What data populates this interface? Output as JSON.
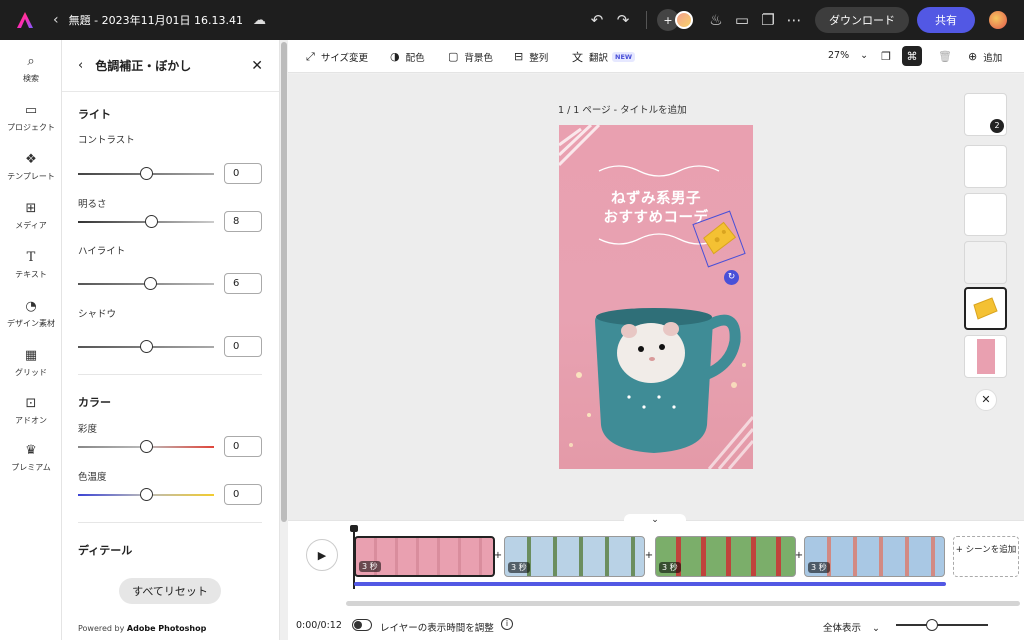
{
  "topbar": {
    "title": "無題 - 2023年11月01日 16.13.41",
    "download_label": "ダウンロード",
    "share_label": "共有"
  },
  "rail": {
    "items": [
      {
        "label": "検索",
        "icon": "search-icon"
      },
      {
        "label": "プロジェクト",
        "icon": "folder-icon"
      },
      {
        "label": "テンプレート",
        "icon": "template-icon"
      },
      {
        "label": "メディア",
        "icon": "media-icon"
      },
      {
        "label": "テキスト",
        "icon": "text-icon"
      },
      {
        "label": "デザイン素材",
        "icon": "shapes-icon"
      },
      {
        "label": "グリッド",
        "icon": "grid-icon"
      },
      {
        "label": "アドオン",
        "icon": "addon-icon"
      },
      {
        "label": "プレミアム",
        "icon": "crown-icon"
      }
    ]
  },
  "panel": {
    "title": "色調補正・ぼかし",
    "light": {
      "title": "ライト",
      "contrast": {
        "label": "コントラスト",
        "value": "0",
        "fraction": 0.5
      },
      "brightness": {
        "label": "明るさ",
        "value": "8",
        "fraction": 0.54
      },
      "highlight": {
        "label": "ハイライト",
        "value": "6",
        "fraction": 0.53
      },
      "shadow": {
        "label": "シャドウ",
        "value": "0",
        "fraction": 0.5
      }
    },
    "color": {
      "title": "カラー",
      "saturation": {
        "label": "彩度",
        "value": "0",
        "fraction": 0.5
      },
      "temperature": {
        "label": "色温度",
        "value": "0",
        "fraction": 0.5
      }
    },
    "detail": {
      "title": "ディテール"
    },
    "reset_label": "すべてリセット",
    "powered_prefix": "Powered by ",
    "powered_brand": "Adobe Photoshop"
  },
  "toolbar": {
    "resize": "サイズ変更",
    "colors": "配色",
    "background": "背景色",
    "arrange": "整列",
    "translate": "翻訳",
    "new_badge": "NEW",
    "zoom": "27%",
    "add": "追加"
  },
  "canvas": {
    "page_label": "1 / 1 ページ - タイトルを追加",
    "headline_1": "ねずみ系男子",
    "headline_2": "おすすめコーデ"
  },
  "thumbs": {
    "badge": "2"
  },
  "timeline": {
    "clips": [
      {
        "duration": "3 秒"
      },
      {
        "duration": "3 秒"
      },
      {
        "duration": "3 秒"
      },
      {
        "duration": "3 秒"
      }
    ],
    "add_scene": "+ シーンを追加",
    "time": "0:00/0:12",
    "layer_label": "レイヤーの表示時間を調整",
    "fit_label": "全体表示"
  },
  "colors": {
    "accent": "#5258e4",
    "topbar": "#1e1e1e",
    "artboard": "#e9a0b0"
  }
}
